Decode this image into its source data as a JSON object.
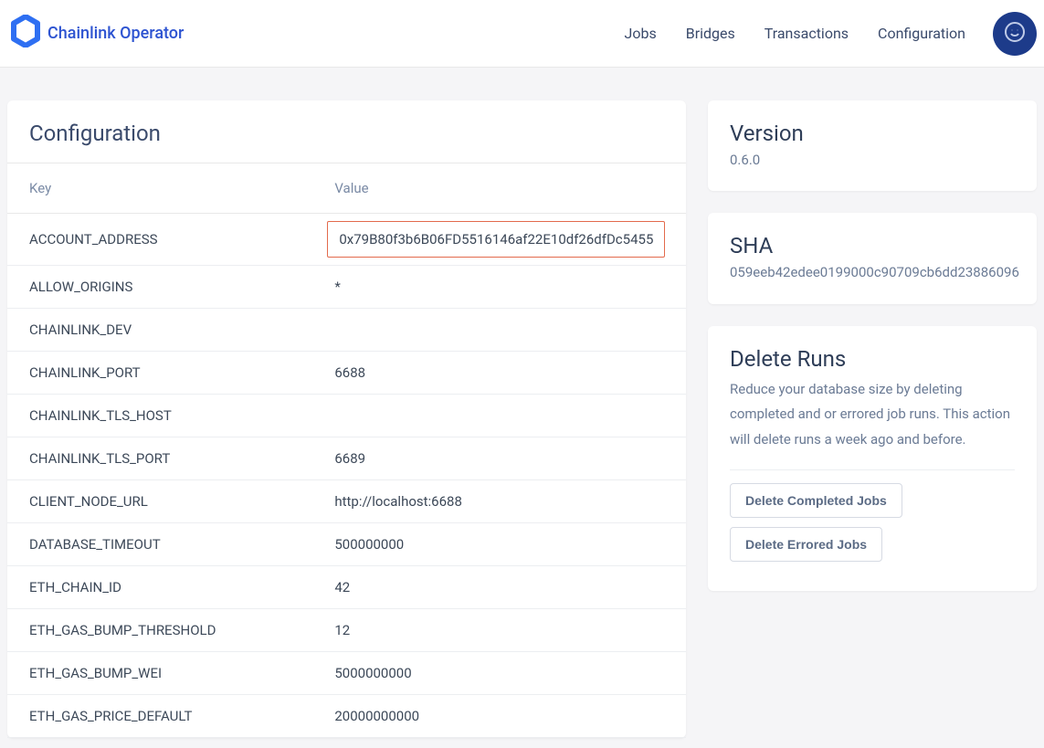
{
  "brand": "Chainlink Operator",
  "nav": {
    "jobs": "Jobs",
    "bridges": "Bridges",
    "transactions": "Transactions",
    "configuration": "Configuration"
  },
  "config": {
    "title": "Configuration",
    "columns": {
      "key": "Key",
      "value": "Value"
    },
    "rows": [
      {
        "k": "ACCOUNT_ADDRESS",
        "v": "0x79B80f3b6B06FD5516146af22E10df26dfDc5455",
        "hl": true
      },
      {
        "k": "ALLOW_ORIGINS",
        "v": "*"
      },
      {
        "k": "CHAINLINK_DEV",
        "v": ""
      },
      {
        "k": "CHAINLINK_PORT",
        "v": "6688"
      },
      {
        "k": "CHAINLINK_TLS_HOST",
        "v": ""
      },
      {
        "k": "CHAINLINK_TLS_PORT",
        "v": "6689"
      },
      {
        "k": "CLIENT_NODE_URL",
        "v": "http://localhost:6688"
      },
      {
        "k": "DATABASE_TIMEOUT",
        "v": "500000000"
      },
      {
        "k": "ETH_CHAIN_ID",
        "v": "42"
      },
      {
        "k": "ETH_GAS_BUMP_THRESHOLD",
        "v": "12"
      },
      {
        "k": "ETH_GAS_BUMP_WEI",
        "v": "5000000000"
      },
      {
        "k": "ETH_GAS_PRICE_DEFAULT",
        "v": "20000000000"
      }
    ]
  },
  "version": {
    "title": "Version",
    "value": "0.6.0"
  },
  "sha": {
    "title": "SHA",
    "value": "059eeb42edee0199000c90709cb6dd23886096"
  },
  "deleteRuns": {
    "title": "Delete Runs",
    "desc": "Reduce your database size by deleting completed and or errored job runs. This action will delete runs a week ago and before.",
    "btnCompleted": "Delete Completed Jobs",
    "btnErrored": "Delete Errored Jobs"
  }
}
